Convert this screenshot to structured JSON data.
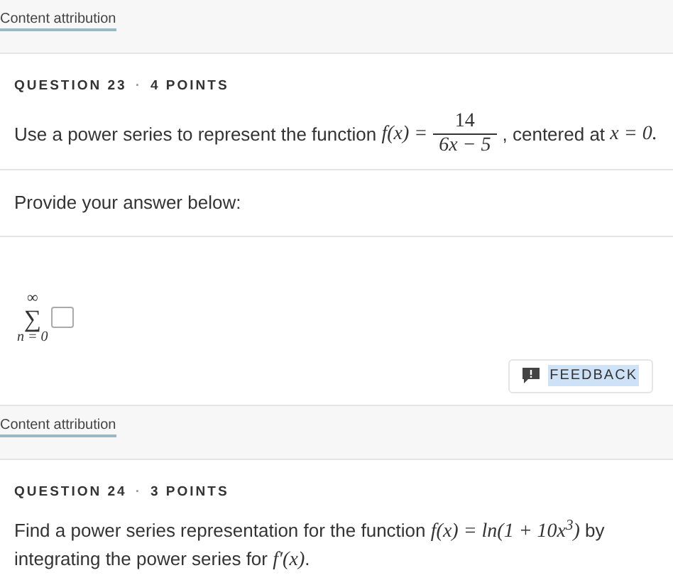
{
  "questions": [
    {
      "attribution": "Content attribution",
      "number": "QUESTION 23",
      "separator": "·",
      "points": "4 POINTS",
      "kind": "fraction",
      "prompt": {
        "before": "Use a power series to represent the function",
        "lhs": "f(x) =",
        "numerator": "14",
        "denominator": "6x − 5",
        "after": ", centered at",
        "math_tail": "x = 0."
      },
      "instruction": "Provide your answer below:",
      "answer": {
        "upper": "∞",
        "symbol": "∑",
        "lower": "n = 0"
      },
      "feedback": "FEEDBACK"
    },
    {
      "attribution": "Content attribution",
      "number": "QUESTION 24",
      "separator": "·",
      "points": "3 POINTS",
      "kind": "inline",
      "prompt": {
        "before": "Find a power series representation for the function",
        "math": "f(x) = ln(1 + 10x$^{3}$)",
        "after": "by integrating the power series for",
        "math_tail": "f′(x)",
        "end": "."
      }
    }
  ]
}
